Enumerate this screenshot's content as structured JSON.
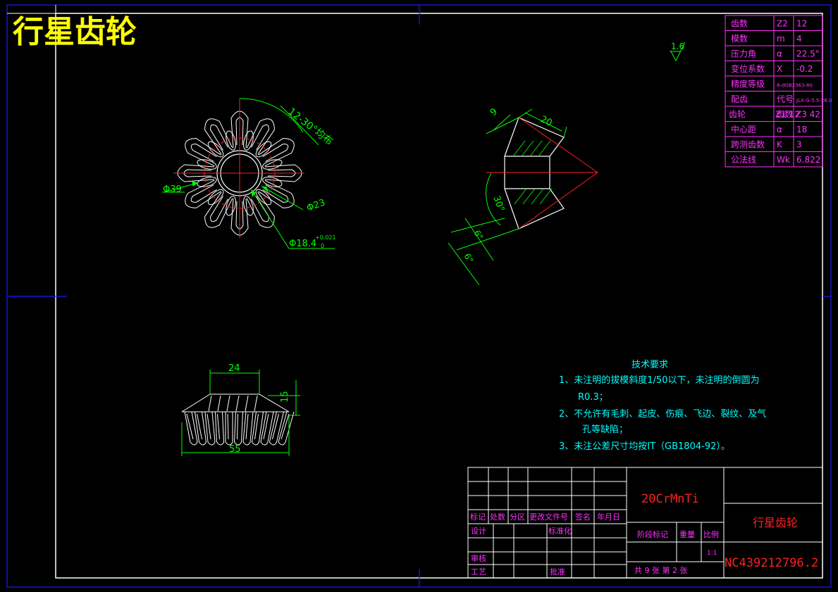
{
  "title": "行星齿轮",
  "roughness": "1.6",
  "gear_params": [
    [
      "齿数",
      "Z2",
      "12"
    ],
    [
      "模数",
      "m",
      "4"
    ],
    [
      "压力角",
      "α",
      "22.5°"
    ],
    [
      "变位系数",
      "X",
      "-0.2"
    ],
    [
      "精度等级",
      "8-dGB2363-80",
      ""
    ],
    [
      "配齿",
      "代号",
      "JLX-G-5.5-26.0"
    ],
    [
      "齿轮",
      "齿数",
      "Z1 12",
      "Z3 42"
    ],
    [
      "中心距",
      "α",
      "18"
    ],
    [
      "跨测齿数",
      "K",
      "3"
    ],
    [
      "公法线",
      "Wk",
      "6.822"
    ]
  ],
  "dims": {
    "angle_uniform": "12-30°均布",
    "phi39": "Φ39",
    "phi23": "Φ23",
    "phi18": "Φ18.4",
    "tol_plus": "+0.021",
    "tol_zero": "0",
    "d20": "20",
    "d9": "9",
    "d30deg": "30°",
    "d6a": "6°",
    "d6b": "6°",
    "d24": "24",
    "d15": "15",
    "d55": "55"
  },
  "tech_req": {
    "heading": "技术要求",
    "line1": "1、未注明的拔模斜度1/50以下，未注明的倒圆为",
    "line1b": "R0.3；",
    "line2": "2、不允许有毛刺、起皮、伤痕、飞边、裂纹、及气",
    "line2b": "孔等缺陷；",
    "line3": "3、未注公差尺寸均按IT（GB1804-92）。"
  },
  "title_block": {
    "material": "20CrMnTi",
    "part_name": "行星齿轮",
    "drawing_no": "NC439212796.2",
    "hdr": [
      "标记",
      "处数",
      "分区",
      "更改文件号",
      "签名",
      "年月日"
    ],
    "design": "设计",
    "standard": "标准化",
    "review": "审核",
    "process": "工艺",
    "approve": "批准",
    "stage": "阶段标记",
    "weight": "重量",
    "scale_lbl": "比例",
    "scale": "1:1",
    "sheets": "共 9 张  第 2 张"
  },
  "colors": {
    "frame": "#ffffff",
    "outline": "#1010ff",
    "dim": "#00ff00",
    "center": "#ff2020",
    "text_magenta": "#ff30ff",
    "text_cyan": "#00ffff",
    "title_yellow": "#ffff00"
  }
}
